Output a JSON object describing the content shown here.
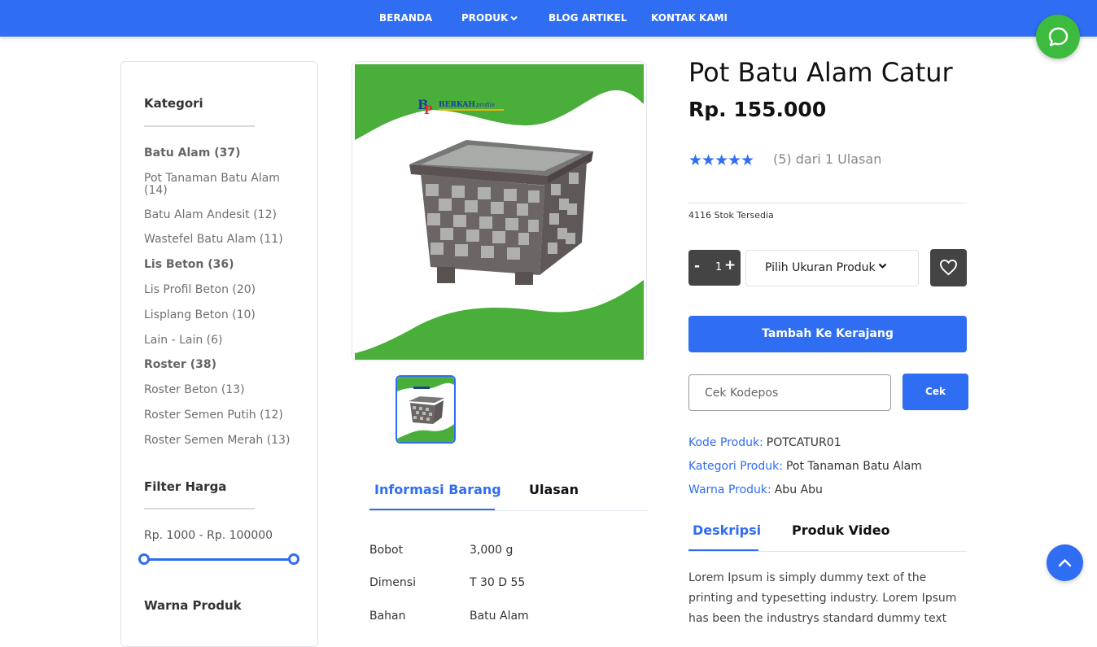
{
  "nav": {
    "items": [
      "BERANDA",
      "PRODUK",
      "BLOG ARTIKEL",
      "KONTAK KAMI"
    ]
  },
  "icons": {
    "chat": "chat-bubble-icon",
    "scroll_top": "chevron-up-icon",
    "wishlist": "heart-icon",
    "dropdown": "chevron-down-icon",
    "brand_color": "#2f6df2",
    "chat_color": "#3dbb3f"
  },
  "sidebar": {
    "category_title": "Kategori",
    "categories": [
      {
        "label": "Batu Alam (37)",
        "bold": true
      },
      {
        "label": "Pot Tanaman Batu Alam (14)",
        "bold": false
      },
      {
        "label": "Batu Alam Andesit (12)",
        "bold": false
      },
      {
        "label": "Wastefel Batu Alam (11)",
        "bold": false
      },
      {
        "label": "Lis Beton (36)",
        "bold": true
      },
      {
        "label": "Lis Profil Beton (20)",
        "bold": false
      },
      {
        "label": "Lisplang Beton (10)",
        "bold": false
      },
      {
        "label": "Lain - Lain (6)",
        "bold": false
      },
      {
        "label": "Roster (38)",
        "bold": true
      },
      {
        "label": "Roster Beton (13)",
        "bold": false
      },
      {
        "label": "Roster Semen Putih (12)",
        "bold": false
      },
      {
        "label": "Roster Semen Merah (13)",
        "bold": false
      }
    ],
    "price_filter_title": "Filter Harga",
    "price_range": "Rp. 1000 - Rp. 100000",
    "color_filter_title": "Warna Produk"
  },
  "gallery": {
    "logo_text": "BERKAH",
    "logo_sub": "profile"
  },
  "info_tabs": {
    "tabs": [
      "Informasi Barang",
      "Ulasan"
    ],
    "specs": [
      {
        "label": "Bobot",
        "value": "3,000 g"
      },
      {
        "label": "Dimensi",
        "value": "T 30 D 55"
      },
      {
        "label": "Bahan",
        "value": "Batu Alam"
      }
    ]
  },
  "product": {
    "title": "Pot Batu Alam Catur",
    "price": "Rp. 155.000",
    "stars": "★★★★★",
    "rating": 5,
    "rating_text": "(5) dari 1 Ulasan",
    "stock": "4116 Stok Tersedia",
    "qty_minus": "-",
    "qty_value": "1",
    "qty_plus": "+",
    "size_select": "Pilih Ukuran Produk",
    "add_to_cart": "Tambah Ke Kerajang",
    "zip_placeholder": "Cek Kodepos",
    "zip_button": "Cek",
    "meta": [
      {
        "key": "Kode Produk:",
        "value": "POTCATUR01"
      },
      {
        "key": "Kategori Produk:",
        "value": "Pot Tanaman Batu Alam"
      },
      {
        "key": "Warna Produk:",
        "value": "Abu Abu"
      }
    ]
  },
  "desc_tabs": {
    "tabs": [
      "Deskripsi",
      "Produk Video"
    ],
    "text": "Lorem Ipsum is simply dummy text of the printing and typesetting industry. Lorem Ipsum has been the industrys standard dummy text"
  }
}
